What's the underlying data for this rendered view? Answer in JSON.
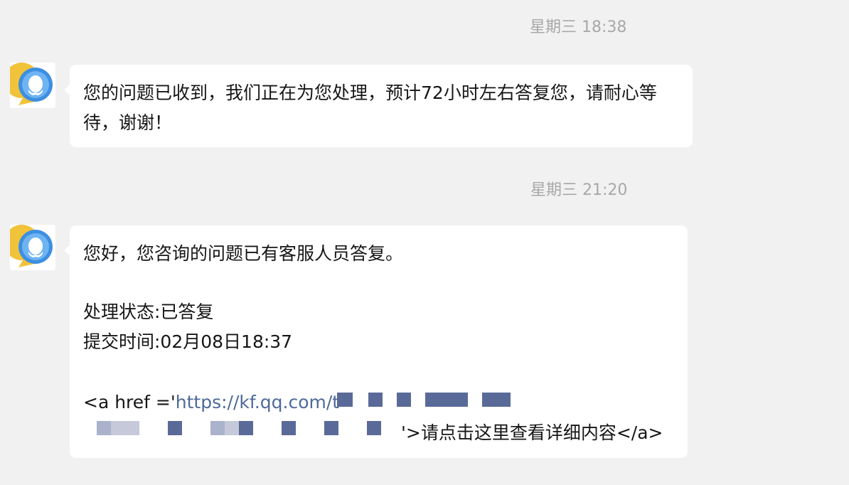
{
  "messages": [
    {
      "timestamp": "星期三 18:38",
      "sender_icon": "qq-customer-service-icon",
      "text": "您的问题已收到，我们正在为您处理，预计72小时左右答复您，请耐心等待，谢谢！"
    },
    {
      "timestamp": "星期三 21:20",
      "sender_icon": "qq-customer-service-icon",
      "greeting": "您好，您咨询的问题已有客服人员答复。",
      "status_line": "处理状态:已答复",
      "submit_time_line": "提交时间:02月08日18:37",
      "anchor_prefix": "<a href ='",
      "link_url": "https://kf.qq.com/t",
      "anchor_suffix": "'>请点击这里查看详细内容</a>"
    }
  ],
  "colors": {
    "background": "#f1f1f1",
    "bubble": "#ffffff",
    "timestamp_text": "#a8a8a8",
    "message_text": "#161616",
    "link": "#4e6a9a",
    "redaction": "#5a6a98",
    "avatar_blue": "#3d8fe0",
    "avatar_yellow": "#f1c33a"
  }
}
